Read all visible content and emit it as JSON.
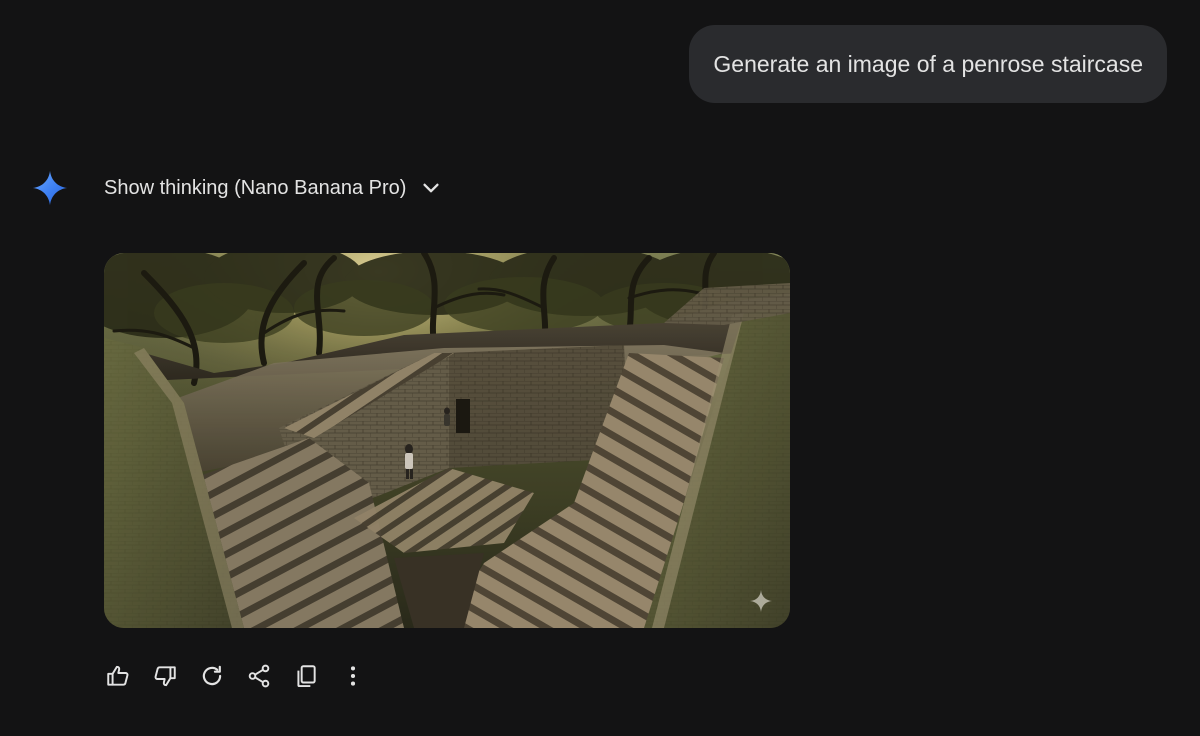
{
  "conversation": {
    "user_message": "Generate an image of a penrose staircase",
    "model_reply": {
      "thinking_toggle_label": "Show thinking (Nano Banana Pro)",
      "image": {
        "alt": "Generated image of a penrose staircase"
      },
      "actions": [
        {
          "name": "thumbs-up-button",
          "icon": "thumbs-up-icon"
        },
        {
          "name": "thumbs-down-button",
          "icon": "thumbs-down-icon"
        },
        {
          "name": "regenerate-button",
          "icon": "redo-icon"
        },
        {
          "name": "share-button",
          "icon": "share-icon"
        },
        {
          "name": "copy-button",
          "icon": "copy-icon"
        },
        {
          "name": "more-options-button",
          "icon": "more-vert-icon"
        }
      ]
    }
  },
  "colors": {
    "background": "#131314",
    "user_bubble": "#2a2b2e",
    "text": "#e3e3e3",
    "gemini_blue": "#4f8ef7"
  }
}
